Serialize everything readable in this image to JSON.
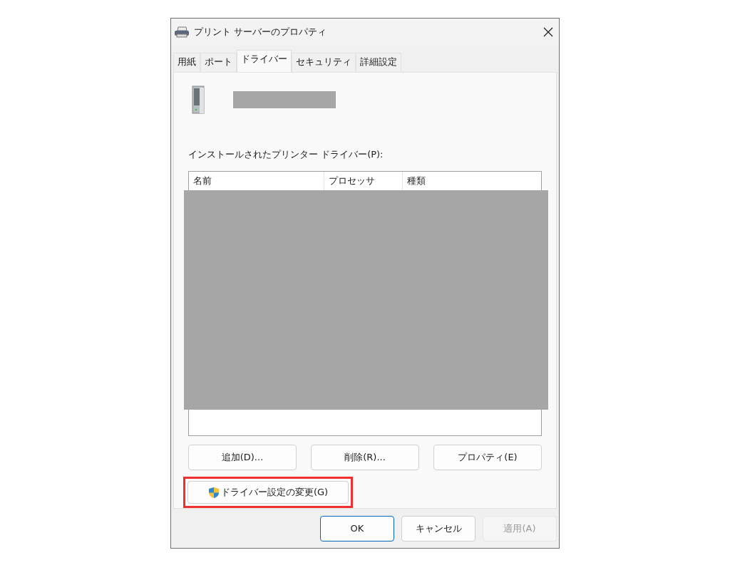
{
  "window": {
    "title": "プリント サーバーのプロパティ"
  },
  "tabs": [
    {
      "label": "用紙",
      "selected": false
    },
    {
      "label": "ポート",
      "selected": false
    },
    {
      "label": "ドライバー",
      "selected": true
    },
    {
      "label": "セキュリティ",
      "selected": false
    },
    {
      "label": "詳細設定",
      "selected": false
    }
  ],
  "drivers": {
    "label": "インストールされたプリンター ドライバー(P):",
    "columns": [
      "名前",
      "プロセッサ",
      "種類"
    ]
  },
  "list_buttons": [
    "追加(D)...",
    "削除(R)...",
    "プロパティ(E)"
  ],
  "change_settings_button": {
    "label": "ドライバー設定の変更(G)",
    "highlighted": true
  },
  "dialog_buttons": [
    {
      "label": "OK",
      "default": true,
      "disabled": false
    },
    {
      "label": "キャンセル",
      "default": false,
      "disabled": false
    },
    {
      "label": "適用(A)",
      "default": false,
      "disabled": true
    }
  ]
}
